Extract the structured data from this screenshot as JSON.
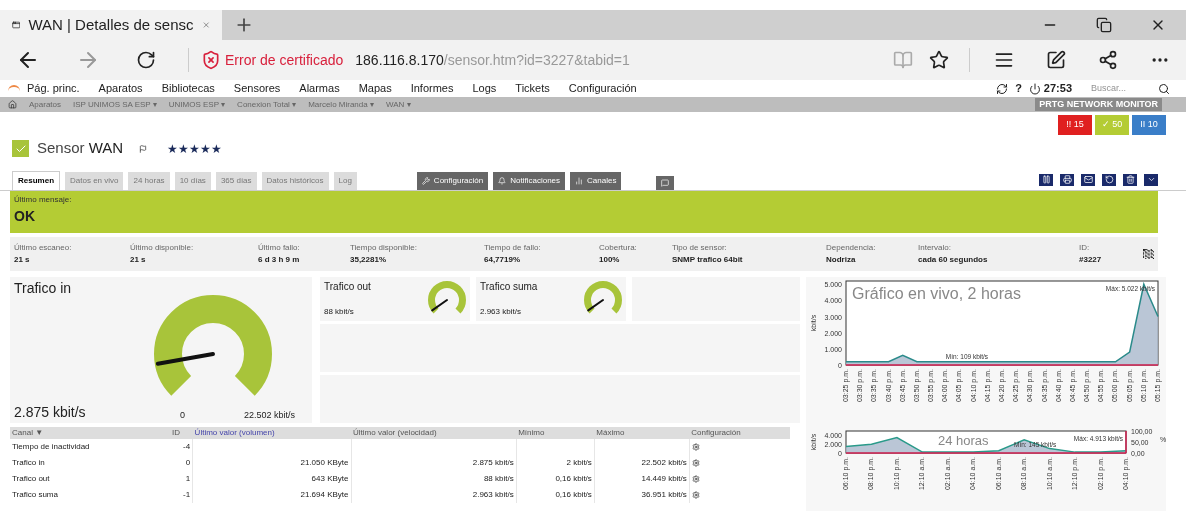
{
  "browser": {
    "tab_title": "WAN | Detalles de sensc",
    "cert_error": "Error de certificado",
    "url_host": "186.116.8.170",
    "url_path": "/sensor.htm?id=3227&tabid=1"
  },
  "menu": {
    "items": [
      "Pág. princ.",
      "Aparatos",
      "Bibliotecas",
      "Sensores",
      "Alarmas",
      "Mapas",
      "Informes",
      "Logs",
      "Tickets",
      "Configuración"
    ],
    "help": "?",
    "timer": "27:53",
    "search": {
      "placeholder": "Buscar..."
    }
  },
  "breadcrumb": {
    "items": [
      {
        "label": "Aparatos"
      },
      {
        "label": "ISP UNIMOS SA ESP",
        "caret": "▾"
      },
      {
        "label": "UNIMOS ESP",
        "caret": "▾"
      },
      {
        "label": "Conexion Total",
        "caret": "▾"
      },
      {
        "label": "Marcelo Miranda",
        "caret": "▾"
      },
      {
        "label": "WAN",
        "caret": "▾"
      }
    ],
    "brand": "PRTG NETWORK MONITOR"
  },
  "status_badges": [
    {
      "icon": "!!",
      "count": "15",
      "color": "#e02020"
    },
    {
      "icon": "✓",
      "count": "50",
      "color": "#b4cc34"
    },
    {
      "icon": "II",
      "count": "10",
      "color": "#3a7ec8"
    }
  ],
  "sensor": {
    "prefix": "Sensor",
    "name": "WAN",
    "stars": 5
  },
  "tabs": [
    {
      "label": "Resumen",
      "selected": true
    },
    {
      "label": "Datos en vivo",
      "selected": false
    },
    {
      "label": "24 horas",
      "selected": false
    },
    {
      "label": "10 días",
      "selected": false
    },
    {
      "label": "365 días",
      "selected": false
    },
    {
      "label": "Datos históricos",
      "selected": false
    },
    {
      "label": "Log",
      "selected": false
    }
  ],
  "actions": [
    {
      "kind": "wrench",
      "label": "Configuración"
    },
    {
      "kind": "bell",
      "label": "Notificaciones"
    },
    {
      "kind": "bars",
      "label": "Canales"
    },
    {
      "kind": "comment"
    }
  ],
  "message": {
    "label": "Último mensaje:",
    "text": "OK"
  },
  "info": [
    {
      "label": "Último escaneo:",
      "value": "21 s"
    },
    {
      "label": "Último disponible:",
      "value": "21 s"
    },
    {
      "label": "Último fallo:",
      "value": "6 d 3 h 9 m"
    },
    {
      "label": "Tiempo disponible:",
      "value": "35,2281%"
    },
    {
      "label": "Tiempo de fallo:",
      "value": "64,7719%"
    },
    {
      "label": "Cobertura:",
      "value": "100%"
    },
    {
      "label": "Tipo de sensor:",
      "value": "SNMP trafico 64bit"
    },
    {
      "label": "Dependencia:",
      "value": "Nodriza"
    },
    {
      "label": "Intervalo:",
      "value": "cada **60 segundos**"
    },
    {
      "label": "ID:",
      "value": "#3227"
    }
  ],
  "gauges": [
    {
      "title": "Trafico in",
      "value": "2.875 kbit/s",
      "min": "0",
      "max": "22.502 kbit/s"
    },
    {
      "title": "Trafico out",
      "value": "88 kbit/s"
    },
    {
      "title": "Trafico suma",
      "value": "2.963 kbit/s"
    }
  ],
  "table": {
    "columns": [
      "Canal ▼",
      "ID",
      "Último valor (volumen)",
      "Último valor (velocidad)",
      "Mínimo",
      "Máximo",
      "Configuración"
    ],
    "rows": [
      [
        "Tiempo de inactividad",
        "-4",
        "",
        "",
        "",
        "",
        ""
      ],
      [
        "Trafico in",
        "0",
        "21.050 KByte",
        "2.875 kbit/s",
        "2 kbit/s",
        "22.502 kbit/s",
        ""
      ],
      [
        "Trafico out",
        "1",
        "643 KByte",
        "88 kbit/s",
        "0,16 kbit/s",
        "14.449 kbit/s",
        ""
      ],
      [
        "Trafico suma",
        "-1",
        "21.694 KByte",
        "2.963 kbit/s",
        "0,16 kbit/s",
        "36.951 kbit/s",
        ""
      ]
    ]
  },
  "live_chart": {
    "chart_data": {
      "type": "area",
      "title": "Gráfico en vivo, 2 horas",
      "ylabel": "kbit/s",
      "categories": [
        "03:25 p.m.",
        "03:30 p.m.",
        "03:35 p.m.",
        "03:40 p.m.",
        "03:45 p.m.",
        "03:50 p.m.",
        "03:55 p.m.",
        "04:00 p.m.",
        "04:05 p.m.",
        "04:10 p.m.",
        "04:15 p.m.",
        "04:20 p.m.",
        "04:25 p.m.",
        "04:30 p.m.",
        "04:35 p.m.",
        "04:40 p.m.",
        "04:45 p.m.",
        "04:50 p.m.",
        "04:55 p.m.",
        "05:00 p.m.",
        "05:05 p.m.",
        "05:10 p.m.",
        "05:15 p.m."
      ],
      "series": [
        {
          "color": "#2a8a8a",
          "values": [
            200,
            200,
            200,
            200,
            600,
            200,
            200,
            200,
            200,
            200,
            200,
            200,
            200,
            200,
            200,
            200,
            200,
            200,
            200,
            200,
            800,
            5000,
            3000
          ]
        }
      ],
      "ylim": [
        0,
        5200
      ],
      "yticks": [
        {
          "value": 0,
          "label": "0"
        },
        {
          "value": 1000,
          "label": "1.000"
        },
        {
          "value": 2000,
          "label": "2.000"
        },
        {
          "value": 3000,
          "label": "3.000"
        },
        {
          "value": 4000,
          "label": "4.000"
        },
        {
          "value": 5000,
          "label": "5.000"
        }
      ],
      "annotations": [
        "Máx: 5.022 kbit/s",
        "Mín: 109 kbit/s"
      ]
    }
  },
  "day_chart": {
    "chart_data": {
      "type": "area",
      "title": "24 horas",
      "ylabel": "kbit/s",
      "categories": [
        "06:10 p.m.",
        "08:10 p.m.",
        "10:10 p.m.",
        "12:10 a.m.",
        "02:10 a.m.",
        "04:10 a.m.",
        "06:10 a.m.",
        "08:10 a.m.",
        "10:10 a.m.",
        "12:10 p.m.",
        "02:10 p.m.",
        "04:10 p.m."
      ],
      "series": [
        {
          "color": "#2a9a8a",
          "values": [
            1500,
            2000,
            3500,
            200,
            200,
            200,
            500,
            3000,
            1000,
            200,
            200,
            500
          ]
        }
      ],
      "ylim": [
        0,
        5000
      ],
      "yticks": [
        {
          "value": 0,
          "label": "0"
        },
        {
          "value": 2000,
          "label": "2.000"
        },
        {
          "value": 4000,
          "label": "4.000"
        }
      ],
      "annotations": [
        "Máx: 4.913 kbit/s",
        "Mín: 145 kbit/s"
      ]
    },
    "right_axis": {
      "label": "%",
      "ticks": [
        "100,00",
        "50,00",
        "0,00"
      ]
    }
  }
}
